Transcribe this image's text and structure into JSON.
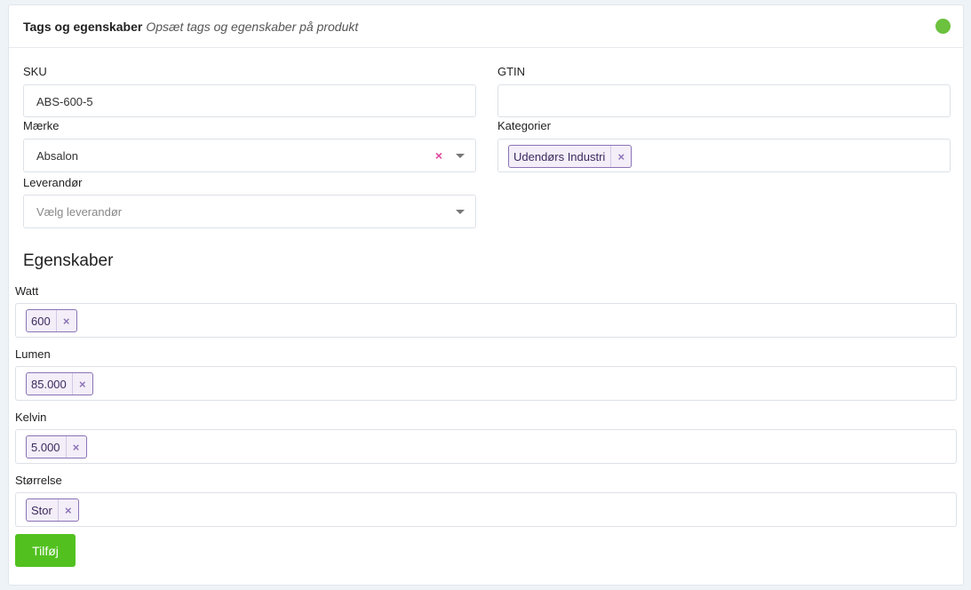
{
  "header": {
    "title": "Tags og egenskaber",
    "subtitle": "Opsæt tags og egenskaber på produkt",
    "status_color": "#6cc13e"
  },
  "fields": {
    "sku": {
      "label": "SKU",
      "value": "ABS-600-5"
    },
    "gtin": {
      "label": "GTIN",
      "value": ""
    },
    "brand": {
      "label": "Mærke",
      "value": "Absalon",
      "clear_icon": "×"
    },
    "categories": {
      "label": "Kategorier",
      "tags": [
        "Udendørs Industri"
      ]
    },
    "supplier": {
      "label": "Leverandør",
      "placeholder": "Vælg leverandør"
    }
  },
  "properties": {
    "title": "Egenskaber",
    "items": [
      {
        "label": "Watt",
        "tags": [
          "600"
        ]
      },
      {
        "label": "Lumen",
        "tags": [
          "85.000"
        ]
      },
      {
        "label": "Kelvin",
        "tags": [
          "5.000"
        ]
      },
      {
        "label": "Størrelse",
        "tags": [
          "Stor"
        ]
      }
    ]
  },
  "tag_remove_icon": "×",
  "add_button": {
    "label": "Tilføj",
    "color": "#52c11f"
  }
}
